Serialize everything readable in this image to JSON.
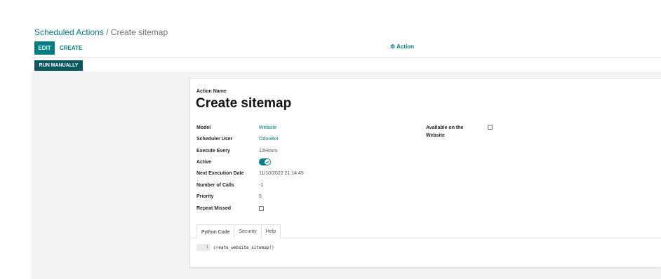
{
  "breadcrumb": {
    "parent": "Scheduled Actions",
    "separator": "/",
    "current": "Create sitemap"
  },
  "control_panel": {
    "edit_label": "EDIT",
    "create_label": "CREATE",
    "action_label": "Action",
    "action_icon": "gear-icon"
  },
  "header_buttons": {
    "run_manually_label": "RUN MANUALLY"
  },
  "form": {
    "name_label": "Action Name",
    "name_value": "Create sitemap",
    "fields": {
      "model": {
        "label": "Model",
        "value": "Website"
      },
      "scheduler_user": {
        "label": "Scheduler User",
        "value": "OdooBot"
      },
      "execute_every": {
        "label": "Execute Every",
        "value": "12Hours"
      },
      "active": {
        "label": "Active",
        "value": true
      },
      "next_execution": {
        "label": "Next Execution Date",
        "value": "11/10/2022 21:14:45"
      },
      "number_of_calls": {
        "label": "Number of Calls",
        "value": "-1"
      },
      "priority": {
        "label": "Priority",
        "value": "5"
      },
      "repeat_missed": {
        "label": "Repeat Missed",
        "value": false
      }
    },
    "available_on_website": {
      "label_line1": "Available on the",
      "label_line2": "Website",
      "value": false
    }
  },
  "tabs": [
    {
      "label": "Python Code",
      "active": true
    },
    {
      "label": "Security",
      "active": false
    },
    {
      "label": "Help",
      "active": false
    }
  ],
  "code": {
    "line_number": "1",
    "text": "create_website_sitemap()"
  },
  "colors": {
    "accent": "#017e84",
    "run_button": "#0b5860",
    "background": "#f2f3f5"
  }
}
